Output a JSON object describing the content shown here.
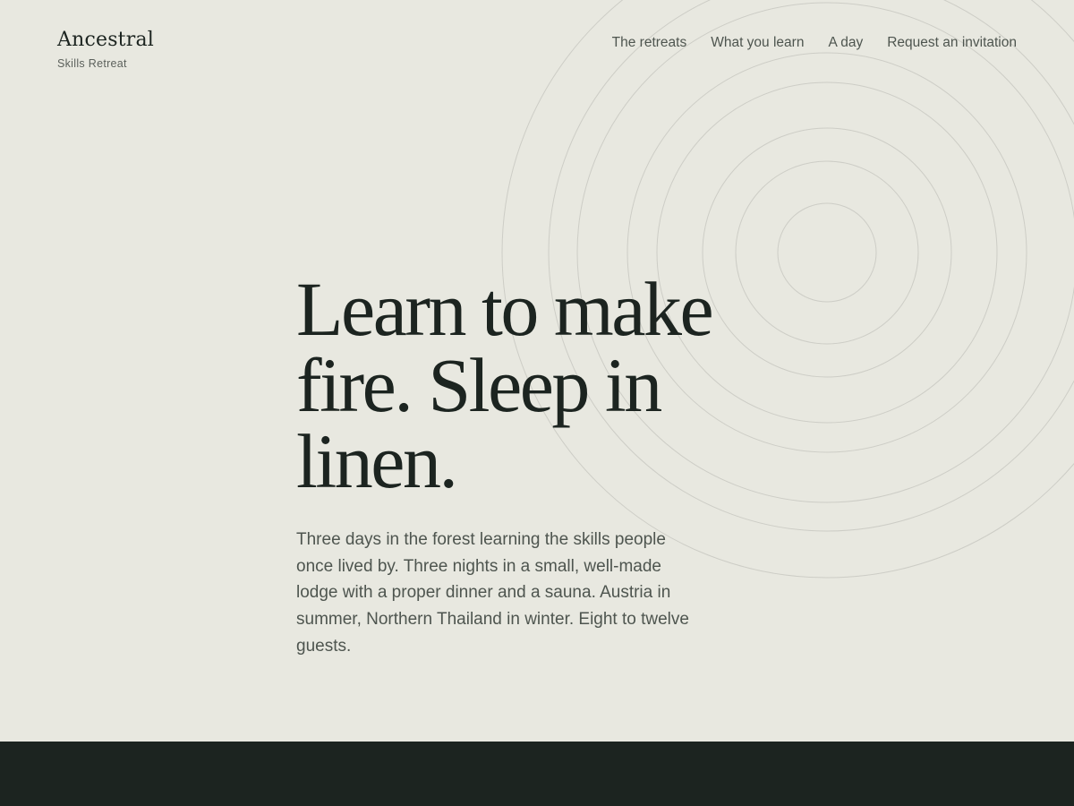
{
  "brand": {
    "name": "Ancestral",
    "subtitle": "Skills Retreat"
  },
  "nav": {
    "items": [
      {
        "label": "The retreats"
      },
      {
        "label": "What you learn"
      },
      {
        "label": "A day"
      },
      {
        "label": "Request an invitation"
      }
    ]
  },
  "hero": {
    "headline": "Learn to make fire. Sleep in linen.",
    "lead": "Three days in the forest learning the skills people once lived by. Three nights in a small, well-made lodge with a proper dinner and a sauna. Austria in summer, Northern Thailand in winter. Eight to twelve guests."
  },
  "colors": {
    "background": "#e8e8e0",
    "text_dark": "#1c2420",
    "text_muted": "#4e554f",
    "ring_stroke": "#cdcdc6",
    "footer_band": "#1c2420"
  },
  "icons": {
    "decoration": "concentric-rings-graphic"
  }
}
